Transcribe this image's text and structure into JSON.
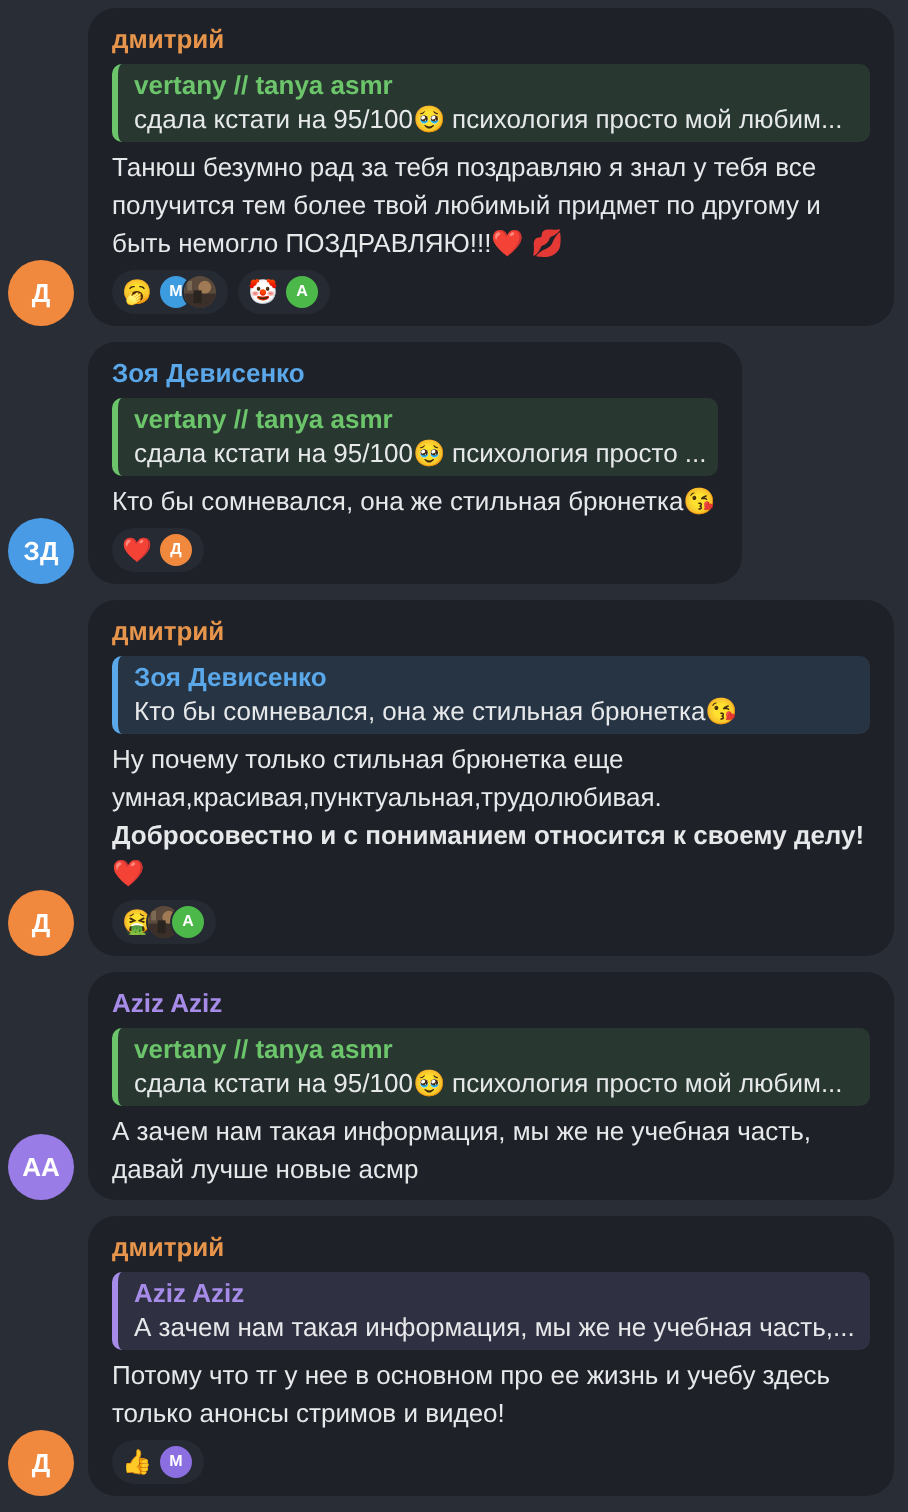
{
  "messages": [
    {
      "author": {
        "name": "дмитрий",
        "color": "#e8954c"
      },
      "avatar": {
        "initials": "Д",
        "color": "#f0883e"
      },
      "reply": {
        "author": "vertany // tanya asmr",
        "color": "#6cc56a",
        "text": "сдала кстати на 95/100🥹 психология просто мой любим..."
      },
      "text": "Танюш безумно рад за тебя поздравляю я знал у тебя все получится тем более твой любимый придмет по другому и быть немогло ПОЗДРАВЛЯЮ!!!❤️ 💋",
      "reactions": [
        {
          "emoji": "🥱",
          "avatars": [
            {
              "kind": "letter",
              "initial": "М",
              "color": "#3d9be0"
            },
            {
              "kind": "picture"
            }
          ]
        },
        {
          "emoji": "🤡",
          "avatars": [
            {
              "kind": "letter",
              "initial": "А",
              "color": "#4cb84a"
            }
          ]
        }
      ]
    },
    {
      "author": {
        "name": "Зоя Девисенко",
        "color": "#5aa8ea"
      },
      "avatar": {
        "initials": "ЗД",
        "color": "#4a9be6"
      },
      "reply": {
        "author": "vertany // tanya asmr",
        "color": "#6cc56a",
        "text": "сдала кстати на 95/100🥹 психология просто ..."
      },
      "text": "Кто бы сомневался, она же стильная брюнетка😘",
      "reactions": [
        {
          "emoji": "❤️",
          "avatars": [
            {
              "kind": "letter",
              "initial": "Д",
              "color": "#f0883e"
            }
          ]
        }
      ]
    },
    {
      "author": {
        "name": "дмитрий",
        "color": "#e8954c"
      },
      "avatar": {
        "initials": "Д",
        "color": "#f0883e"
      },
      "reply": {
        "author": "Зоя Девисенко",
        "color": "#5aa8ea",
        "text": "Кто бы сомневался, она же стильная брюнетка😘"
      },
      "text": "Ну почему только стильная брюнетка еще умная,красивая,пунктуальная,трудолюбивая. **Добросовестно и с пониманием относится к своему делу!** ❤️",
      "reactions": [
        {
          "emoji": "🤮",
          "avatars": [
            {
              "kind": "picture"
            },
            {
              "kind": "letter",
              "initial": "А",
              "color": "#4cb84a"
            }
          ]
        }
      ]
    },
    {
      "author": {
        "name": "Aziz Aziz",
        "color": "#a68ce8"
      },
      "avatar": {
        "initials": "АА",
        "color": "#9a7ce6"
      },
      "reply": {
        "author": "vertany // tanya asmr",
        "color": "#6cc56a",
        "text": "сдала кстати на 95/100🥹 психология просто мой любим..."
      },
      "text": "А зачем нам такая информация, мы же не учебная часть, давай лучше новые асмр"
    },
    {
      "author": {
        "name": "дмитрий",
        "color": "#e8954c"
      },
      "avatar": {
        "initials": "Д",
        "color": "#f0883e"
      },
      "reply": {
        "author": "Aziz Aziz",
        "color": "#a68ce8",
        "text": "А зачем нам такая информация, мы же не учебная часть,..."
      },
      "text": "Потому что тг у нее в основном про ее жизнь и учебу здесь только анонсы стримов и видео!",
      "reactions": [
        {
          "emoji": "👍",
          "avatars": [
            {
              "kind": "letter",
              "initial": "М",
              "color": "#8b6ee0"
            }
          ]
        }
      ]
    }
  ]
}
